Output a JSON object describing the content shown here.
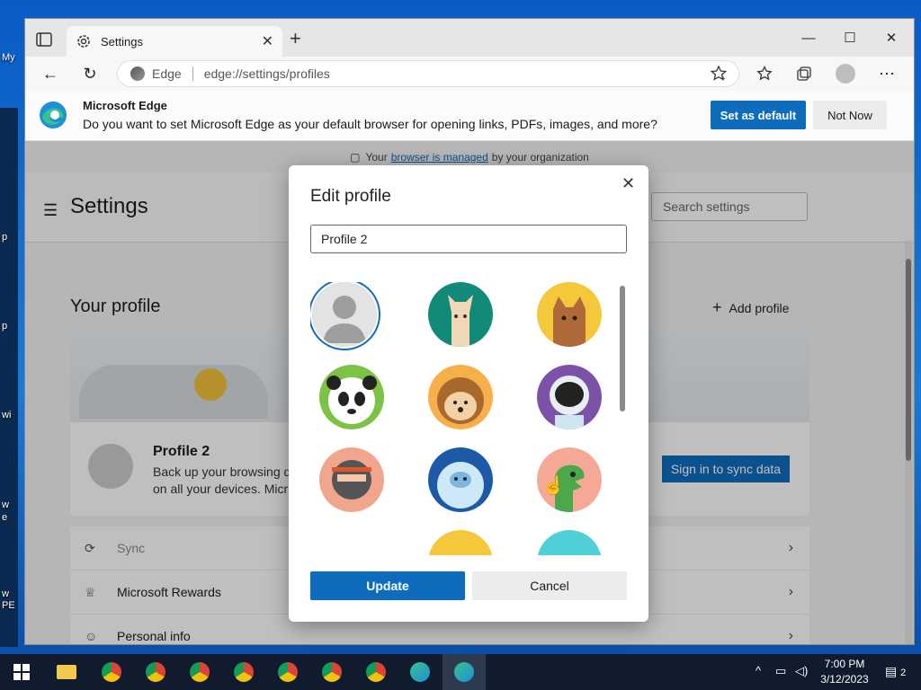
{
  "desktop": {
    "labels": [
      "My",
      "p",
      "p",
      "wi",
      "w",
      "e",
      "w",
      "PE"
    ]
  },
  "browser": {
    "tab_title": "Settings",
    "address_label": "Edge",
    "address_url": "edge://settings/profiles"
  },
  "infobar": {
    "title": "Microsoft Edge",
    "message": "Do you want to set Microsoft Edge as your default browser for opening links, PDFs, images, and more?",
    "set_default": "Set as default",
    "not_now": "Not Now"
  },
  "settings": {
    "managed_prefix": "Your",
    "managed_link": "browser is managed",
    "managed_suffix": "by your organization",
    "title": "Settings",
    "search_placeholder": "Search settings",
    "your_profile": "Your profile",
    "add_profile": "Add profile",
    "profile_name": "Profile 2",
    "profile_desc_1": "Back up your browsing d",
    "profile_desc_2": "on all your devices. Micr",
    "sync_button": "Sign in to sync data",
    "rows": [
      {
        "label": "Sync",
        "icon": "sync-icon"
      },
      {
        "label": "Microsoft Rewards",
        "icon": "trophy-icon"
      },
      {
        "label": "Personal info",
        "icon": "person-info-icon"
      }
    ]
  },
  "modal": {
    "title": "Edit profile",
    "name_value": "Profile 2",
    "avatars": [
      "default-person",
      "llama",
      "cat",
      "panda",
      "hedgehog",
      "astronaut",
      "ninja",
      "yeti",
      "dinosaur"
    ],
    "update": "Update",
    "cancel": "Cancel"
  },
  "taskbar": {
    "time": "7:00 PM",
    "date": "3/12/2023",
    "notifications": "2"
  },
  "colors": {
    "accent": "#0f6cbd"
  }
}
